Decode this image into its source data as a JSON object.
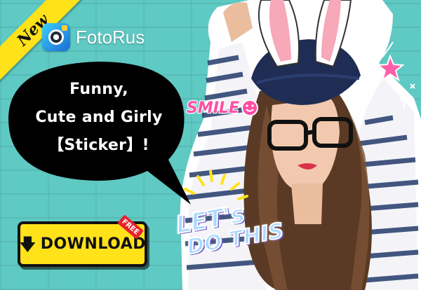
{
  "ribbon": {
    "label": "New"
  },
  "brand": {
    "name": "FotoRus",
    "icon": "camera-lens-icon"
  },
  "bubble": {
    "line1": "Funny,",
    "line2": "Cute and Girly",
    "line3": "【Sticker】!"
  },
  "download": {
    "label": "DOWNLOAD",
    "arrow": "🡇",
    "badge": "FREE"
  },
  "stickers": {
    "smile": "SMILE",
    "lets_line1": "LET's",
    "lets_line2": "DO THIS"
  },
  "colors": {
    "background": "#5fc9c4",
    "accent_yellow": "#ffe21a",
    "sticker_pink": "#ff4fa3",
    "badge_red": "#e8212c"
  }
}
